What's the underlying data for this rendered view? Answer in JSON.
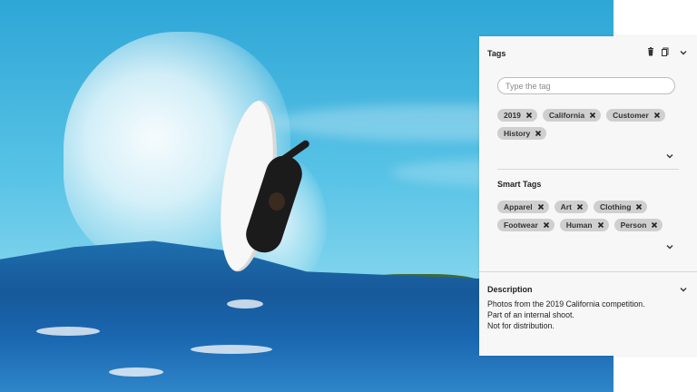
{
  "tags_panel": {
    "title": "Tags",
    "input": {
      "placeholder": "Type the tag",
      "value": ""
    },
    "tags": [
      "2019",
      "California",
      "Customer",
      "History"
    ]
  },
  "smart_tags": {
    "title": "Smart Tags",
    "tags": [
      "Apparel",
      "Art",
      "Clothing",
      "Footwear",
      "Human",
      "Person"
    ]
  },
  "description": {
    "title": "Description",
    "lines": [
      "Photos from the 2019 California competition.",
      "Part of an internal shoot.",
      "Not for distribution."
    ]
  },
  "icons": {
    "delete": "trash-icon",
    "copy": "copy-icon",
    "collapse": "chevron-down-icon",
    "remove_tag": "close-icon"
  },
  "colors": {
    "panel_bg": "#f7f7f7",
    "chip_bg": "#cfcfcf",
    "text": "#222222"
  }
}
